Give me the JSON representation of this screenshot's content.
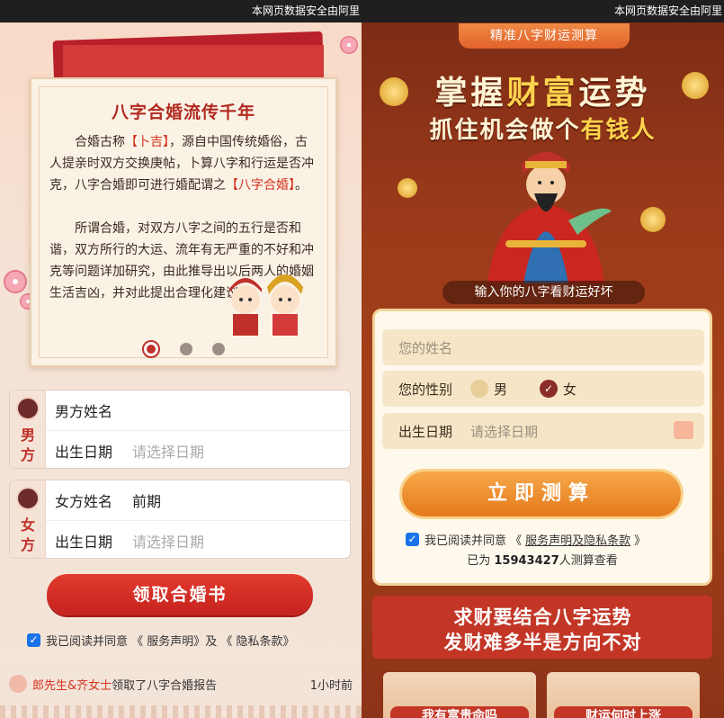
{
  "left": {
    "topbar_text": "本网页数据安全由阿里",
    "card": {
      "title": "八字合婚流传千年",
      "p1_a": "合婚古称",
      "p1_hl1": "【卜吉】",
      "p1_b": "，源自中国传统婚俗，古人提亲时双方交换庚帖，卜算八字和行运是否冲克，八字合婚即可进行婚配谓之",
      "p1_hl2": "【八字合婚】",
      "p1_c": "。",
      "p2": "所谓合婚，对双方八字之间的五行是否和谐，双方所行的大运、流年有无严重的不好和冲克等问题详加研究，由此推导出以后两人的婚姻生活吉凶，并对此提出合理化建议。"
    },
    "male": {
      "tag_1": "男",
      "tag_2": "方",
      "name_label": "男方姓名",
      "name_value": "",
      "date_label": "出生日期",
      "date_placeholder": "请选择日期"
    },
    "female": {
      "tag_1": "女",
      "tag_2": "方",
      "name_label": "女方姓名",
      "name_value": "前期",
      "date_label": "出生日期",
      "date_placeholder": "请选择日期"
    },
    "submit_label": "领取合婚书",
    "agree": {
      "checked": true,
      "check_mark": "✓",
      "text": "我已阅读并同意 《 服务声明》及 《 隐私条款》"
    },
    "recent": {
      "who": "郎先生&齐女士",
      "action": "领取了八字合婚报告",
      "time": "1小时前"
    }
  },
  "right": {
    "topbar_text": "本网页数据安全由阿里",
    "ribbon": "精准八字财运测算",
    "hero_line1_a": "掌握",
    "hero_line1_b": "财富",
    "hero_line1_c": "运势",
    "hero_line2_a": "抓住机会做个",
    "hero_line2_b": "有钱人",
    "hero_caption": "输入你的八字看财运好坏",
    "form": {
      "name_placeholder": "您的姓名",
      "gender_label": "您的性别",
      "gender_male": "男",
      "gender_female": "女",
      "gender_selected": "女",
      "check_mark": "✓",
      "date_label": "出生日期",
      "date_placeholder": "请选择日期"
    },
    "submit_label": "立即测算",
    "agree": {
      "checked": true,
      "check_mark": "✓",
      "text_a": "我已阅读并同意 《",
      "link": "服务声明及隐私条款",
      "text_b": "》"
    },
    "count": {
      "prefix": "已为",
      "number": "15943427",
      "suffix": "人测算查看"
    },
    "banner_line1": "求财要结合八字运势",
    "banner_line2": "发财难多半是方向不对",
    "tiles": [
      "我有富贵命吗",
      "财运何时上涨"
    ]
  }
}
